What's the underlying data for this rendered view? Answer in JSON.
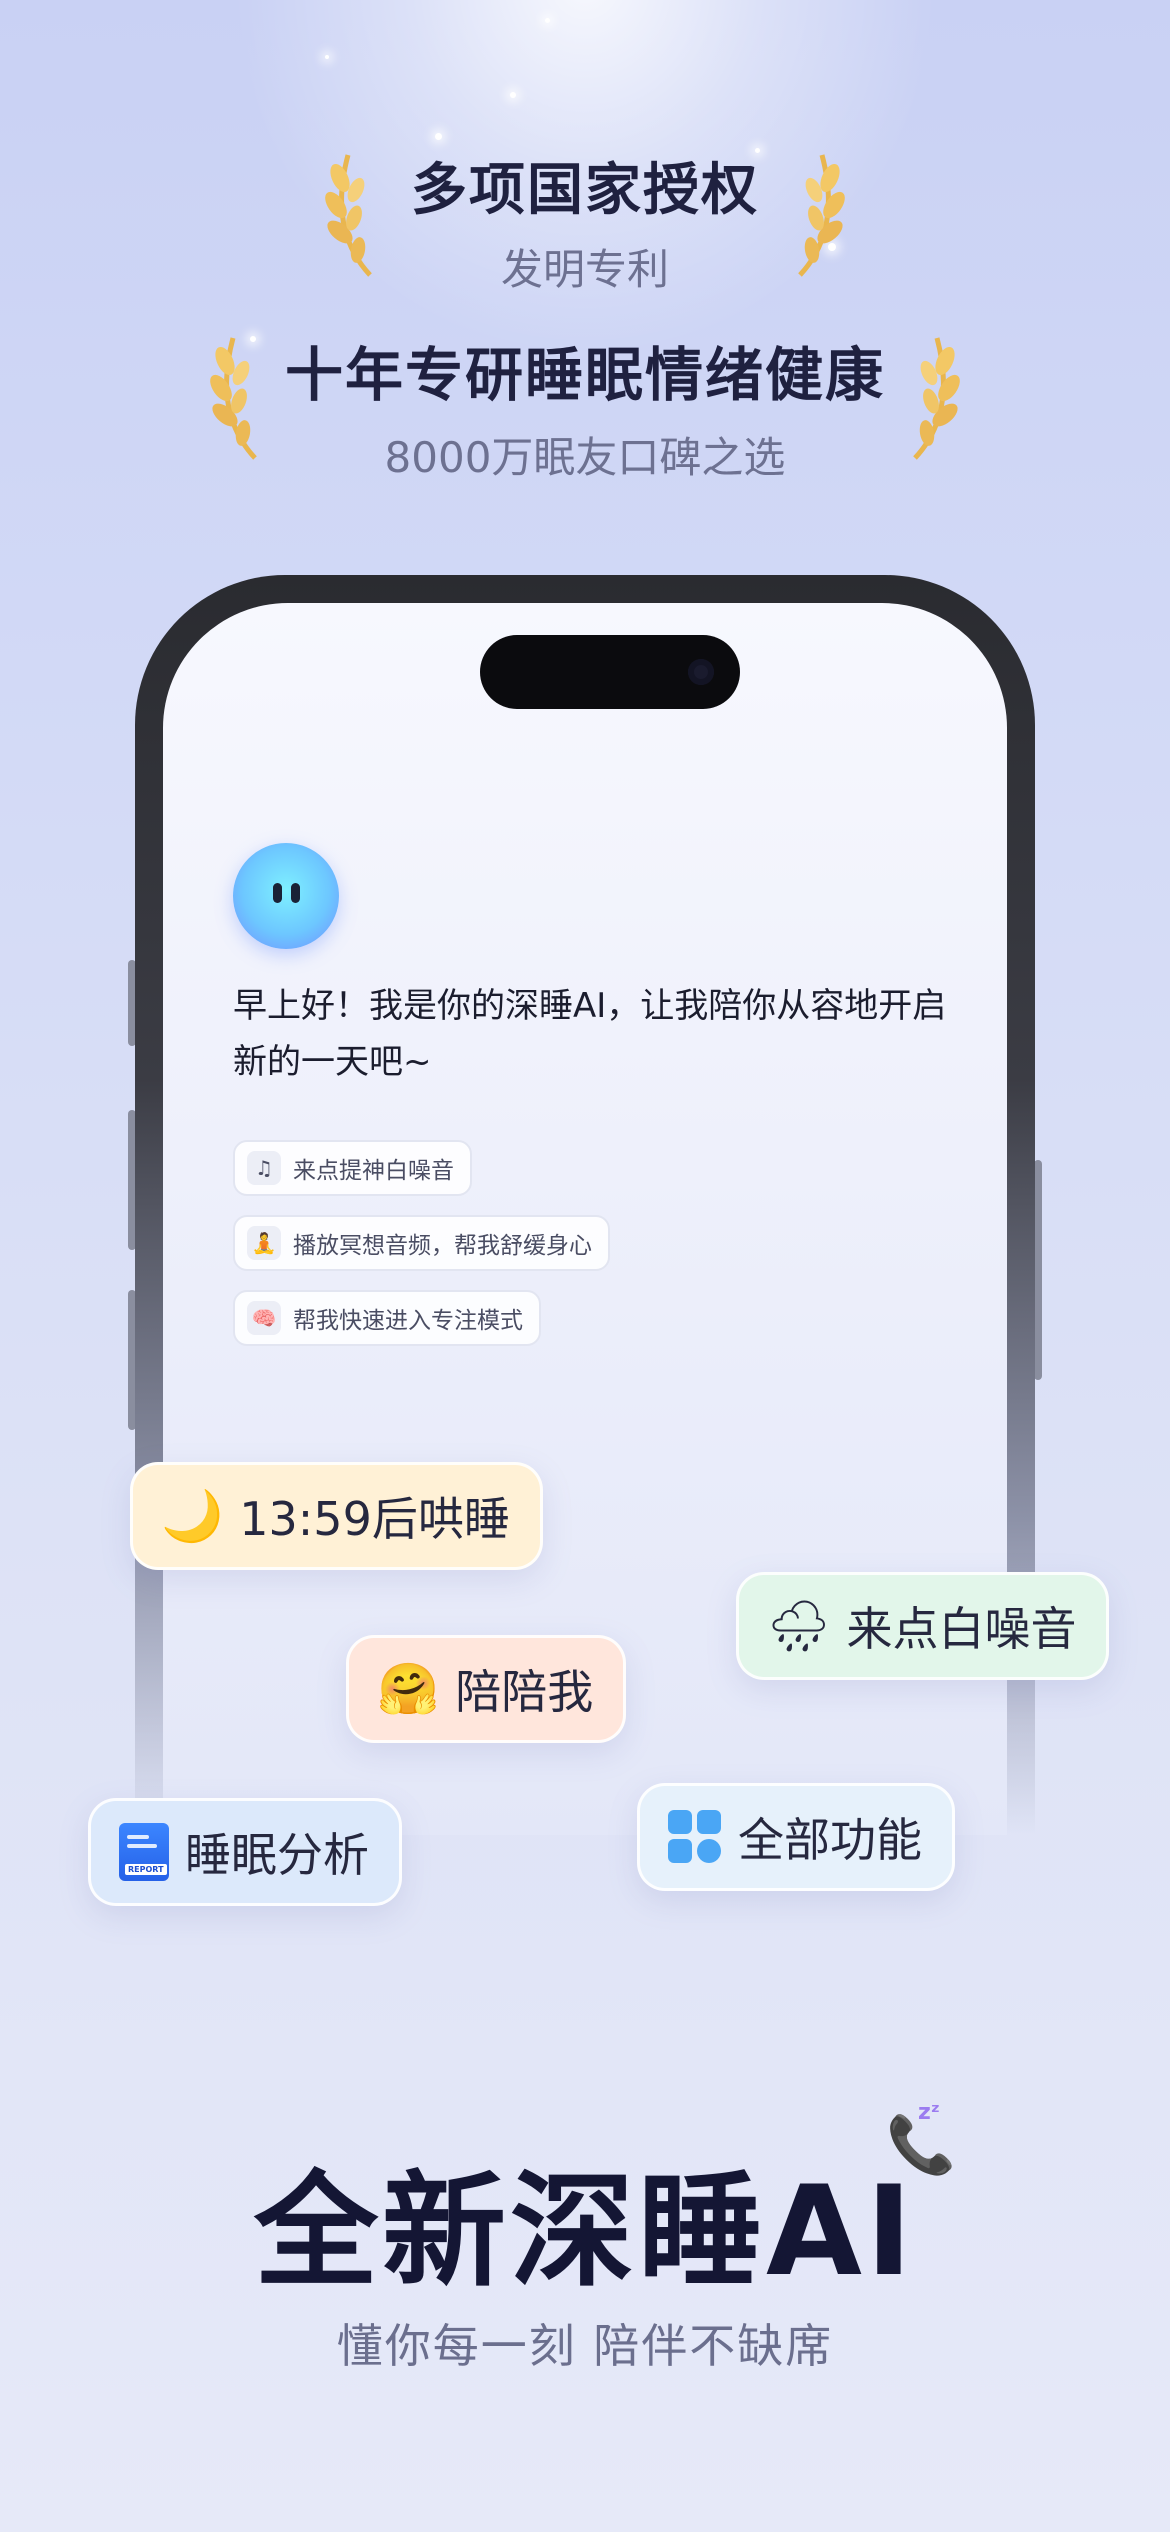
{
  "awards": [
    {
      "title": "多项国家授权",
      "subtitle": "发明专利"
    },
    {
      "title": "十年专研睡眠情绪健康",
      "subtitle": "8000万眠友口碑之选"
    }
  ],
  "chat": {
    "greeting": "早上好！我是你的深睡AI，让我陪你从容地开启新的一天吧~",
    "suggestions": [
      {
        "icon": "music-note-icon",
        "glyph": "♫",
        "label": "来点提神白噪音"
      },
      {
        "icon": "meditation-icon",
        "glyph": "🧘",
        "label": "播放冥想音频，帮我舒缓身心"
      },
      {
        "icon": "brain-icon",
        "glyph": "🧠",
        "label": "帮我快速进入专注模式"
      }
    ]
  },
  "pills": {
    "timer": {
      "icon": "crescent-moon-icon",
      "glyph": "🌙",
      "label": "13:59后哄睡"
    },
    "noise": {
      "icon": "rain-cloud-icon",
      "glyph": "🌧",
      "label": "来点白噪音"
    },
    "company": {
      "icon": "hugging-face-icon",
      "glyph": "🤗",
      "label": "陪陪我"
    },
    "analysis": {
      "icon": "report-icon",
      "badge": "REPORT",
      "label": "睡眠分析"
    },
    "all": {
      "icon": "grid-apps-icon",
      "label": "全部功能"
    }
  },
  "headline": "全新深睡AI",
  "headline_icon": {
    "icon": "telephone-sleep-icon",
    "glyph": "📞",
    "badge": "zᶻ"
  },
  "tagline": "懂你每一刻 陪伴不缺席",
  "colors": {
    "background": "#d3daf6",
    "gold": "#f0c15a",
    "avatar": "#6dc7ff"
  }
}
